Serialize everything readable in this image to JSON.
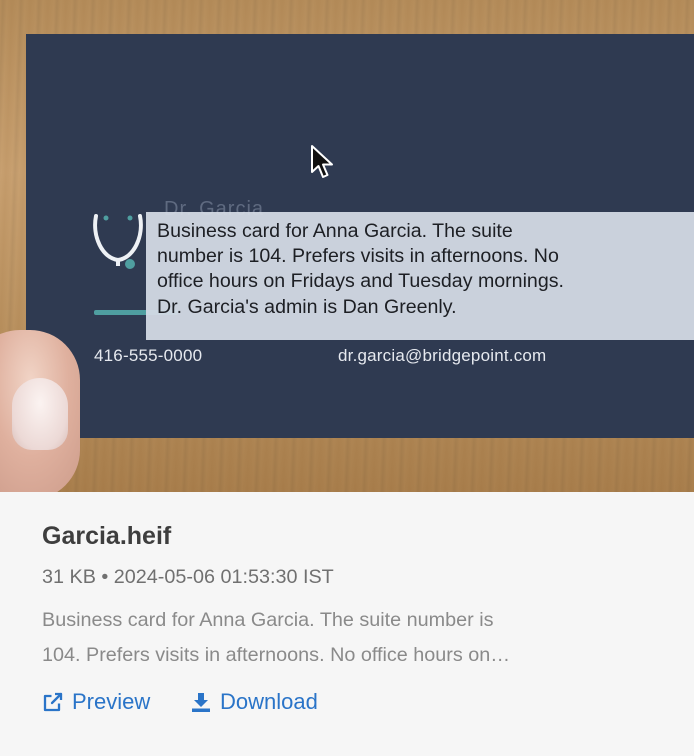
{
  "photo": {
    "card_phone": "416-555-0000",
    "card_email": "dr.garcia@bridgepoint.com",
    "card_name_partial": "Dr. Garcia"
  },
  "tooltip": {
    "lines": [
      "Business card for Anna Garcia. The suite",
      "number is 104. Prefers visits in afternoons. No",
      "office hours on Fridays and Tuesday mornings.",
      "Dr. Garcia's admin is Dan Greenly."
    ]
  },
  "file": {
    "name": "Garcia.heif",
    "info": "31 KB • 2024-05-06 01:53:30 IST",
    "description_lines": [
      "Business card for Anna Garcia. The suite number is",
      "104. Prefers visits in afternoons. No office hours on…"
    ]
  },
  "actions": {
    "preview_label": "Preview",
    "preview_icon": "external-link-icon",
    "download_label": "Download",
    "download_icon": "download-icon"
  },
  "colors": {
    "card_background": "#2f3a51",
    "accent_teal": "#4f9ea0",
    "link_blue": "#2a74c8"
  }
}
